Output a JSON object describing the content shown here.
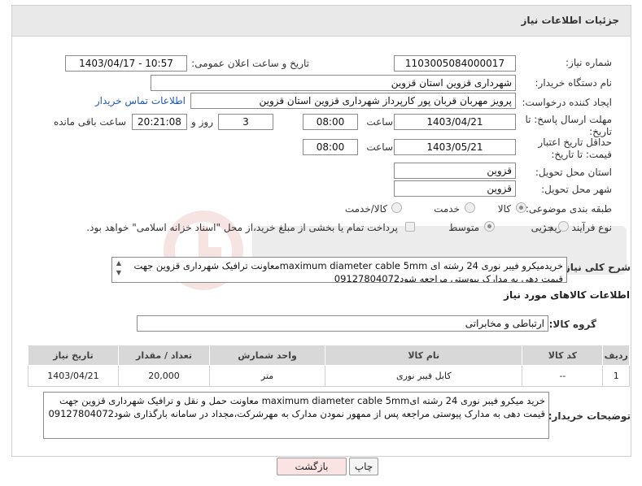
{
  "header": {
    "title": "جزئیات اطلاعات نیاز"
  },
  "fields": {
    "need_number_label": "شماره نیاز:",
    "need_number": "1103005084000017",
    "announce_label": "تاریخ و ساعت اعلان عمومی:",
    "announce_value": "1403/04/17 - 10:57",
    "buyer_org_label": "نام دستگاه خریدار:",
    "buyer_org": "شهرداری قزوین استان قزوین",
    "requester_label": "ایجاد کننده درخواست:",
    "requester": "پرویز مهربان قربان پور کارپرداز شهرداری قزوین استان قزوین",
    "contact_link": "اطلاعات تماس خریدار",
    "deadline_label": "مهلت ارسال پاسخ: تا تاریخ:",
    "deadline_date": "1403/04/21",
    "time_label": "ساعت",
    "deadline_time": "08:00",
    "days_value": "3",
    "days_label": "روز و",
    "remaining_time": "20:21:08",
    "remaining_label": "ساعت باقی مانده",
    "validity_label": "حداقل تاریخ اعتبار قیمت: تا تاریخ:",
    "validity_date": "1403/05/21",
    "validity_time_label": "ساعت",
    "validity_time": "08:00",
    "province_label": "استان محل تحویل:",
    "province": "قزوین",
    "city_label": "شهر محل تحویل:",
    "city": "قزوین",
    "category_label": "طبقه بندی موضوعی:",
    "category_options": [
      "کالا",
      "خدمت",
      "کالا/خدمت"
    ],
    "process_label": "نوع فرآیند خرید :",
    "process_options": [
      "جزیی",
      "متوسط"
    ],
    "payment_note": "پرداخت تمام یا بخشی از مبلغ خرید،از محل \"اسناد خزانه اسلامی\" خواهد بود."
  },
  "description": {
    "label": "شرح کلی نیاز:",
    "text": "خریدمیکرو فیبر نوری 24 رشته ای maximum diameter cable 5mmمعاونت ترافیک شهرداری قزوین جهت قیمت دهی به مدارک پیوستی مراجعه شود09127804072"
  },
  "goods_section": {
    "title": "اطلاعات کالاهای مورد نیاز",
    "group_label": "گروه کالا:",
    "group_value": "ارتباطی و مخابراتی"
  },
  "table": {
    "headers": [
      "ردیف",
      "کد کالا",
      "نام کالا",
      "واحد شمارش",
      "تعداد / مقدار",
      "تاریخ نیاز"
    ],
    "rows": [
      [
        "1",
        "--",
        "کابل فیبر نوری",
        "متر",
        "20,000",
        "1403/04/21"
      ]
    ]
  },
  "buyer_notes": {
    "label": "توضیحات خریدار:",
    "text": "خرید میکرو فیبر نوری 24 رشته ایmaximum diameter cable 5mm معاونت حمل و نقل و ترافیک شهرداری قزوین جهت قیمت دهی به مدارک پیوستی مراجعه پس از ممهور نمودن مدارک به مهرشرکت،مجداد در سامانه بارگذاری شود09127804072"
  },
  "buttons": {
    "print": "چاپ",
    "back": "بازگشت"
  },
  "colors": {
    "link": "#1f58b5",
    "back_button_bg": "#fbe3e3",
    "header_bg": "#e9e9e9"
  }
}
